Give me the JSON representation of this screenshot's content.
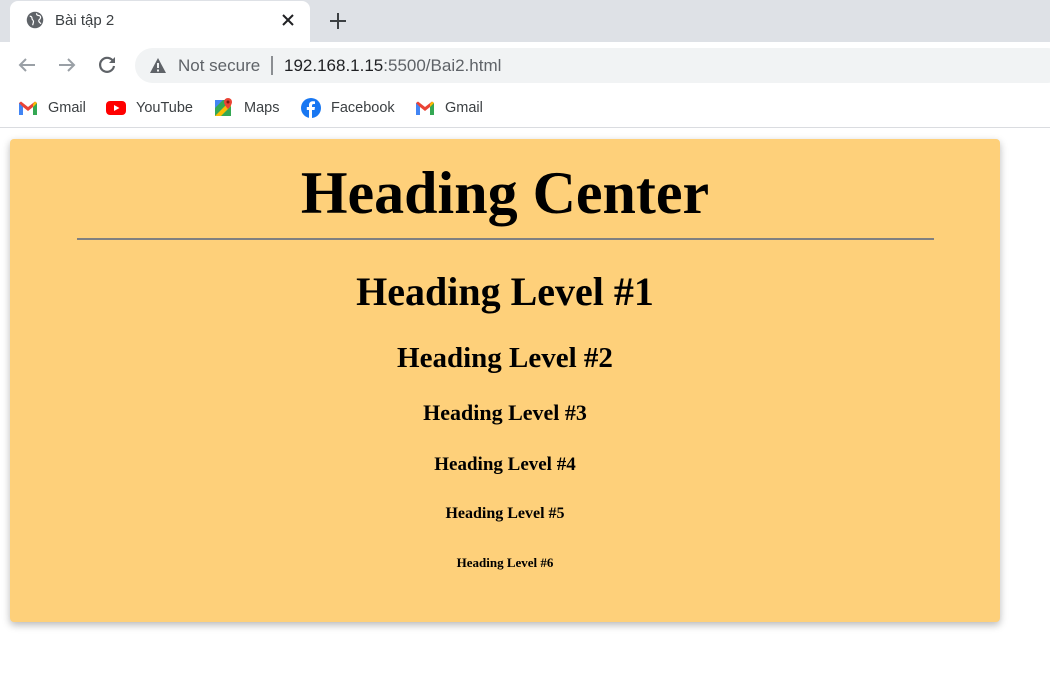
{
  "browser": {
    "tab": {
      "title": "Bài tập 2",
      "icon": "globe-icon"
    },
    "new_tab_icon": "plus-icon",
    "omnibox": {
      "security_label": "Not secure",
      "url_host": "192.168.1.15",
      "url_rest": ":5500/Bai2.html"
    },
    "bookmarks": [
      {
        "label": "Gmail",
        "icon": "gmail-icon"
      },
      {
        "label": "YouTube",
        "icon": "youtube-icon"
      },
      {
        "label": "Maps",
        "icon": "maps-icon"
      },
      {
        "label": "Facebook",
        "icon": "facebook-icon"
      },
      {
        "label": "Gmail",
        "icon": "gmail-icon"
      }
    ]
  },
  "page": {
    "background_color": "#fed07a",
    "heading_center": "Heading Center",
    "h1": "Heading Level #1",
    "h2": "Heading Level #2",
    "h3": "Heading Level #3",
    "h4": "Heading Level #4",
    "h5": "Heading Level #5",
    "h6": "Heading Level #6"
  }
}
